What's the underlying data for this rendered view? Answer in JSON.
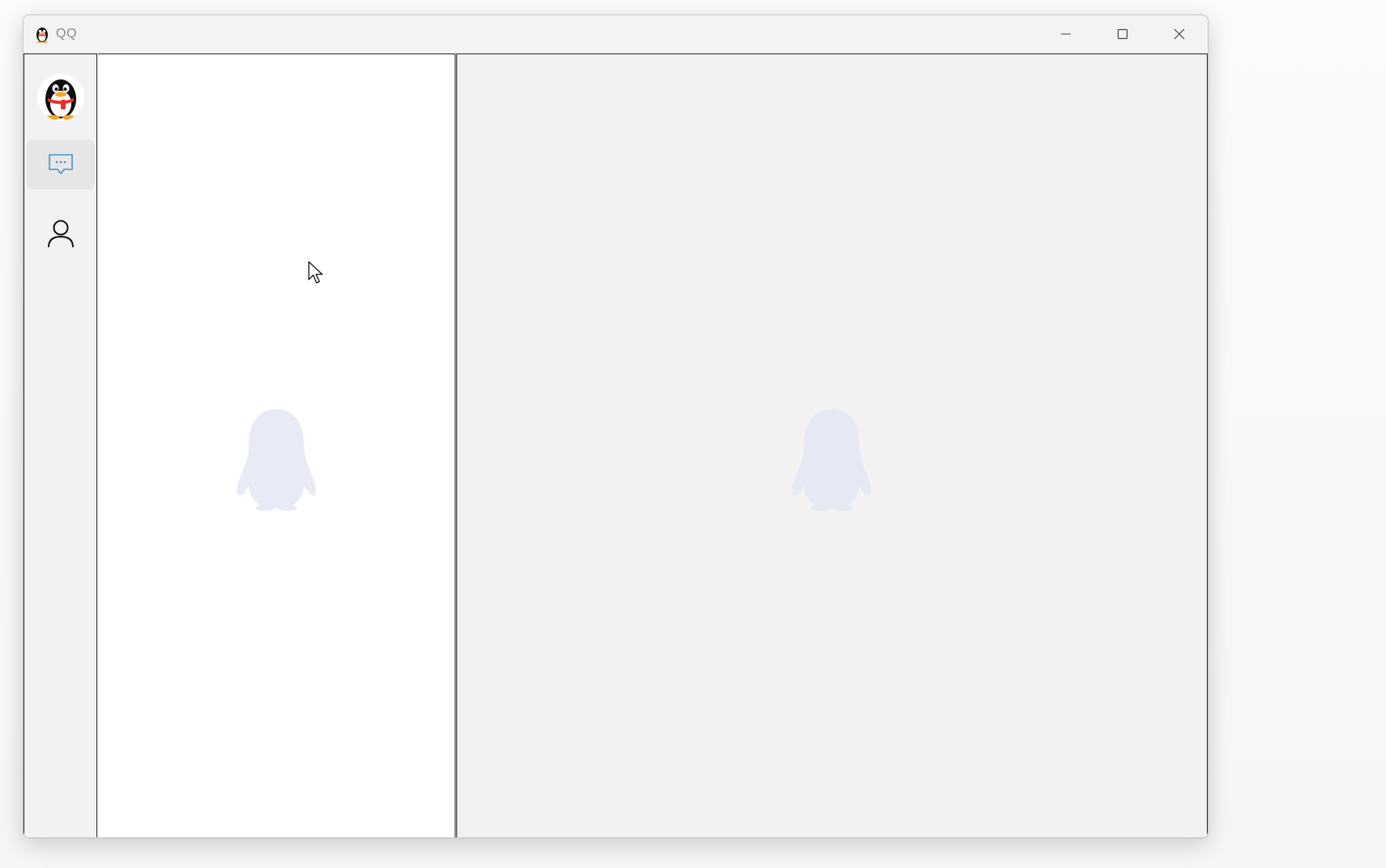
{
  "window": {
    "title": "QQ"
  },
  "title_controls": {
    "minimize_icon": "minimize-icon",
    "maximize_icon": "maximize-icon",
    "close_icon": "close-icon"
  },
  "sidebar": {
    "items": [
      {
        "icon": "chat-bubble-icon",
        "active": true
      },
      {
        "icon": "person-icon",
        "active": false
      }
    ]
  },
  "colors": {
    "accent": "#4a90c8",
    "placeholder": "#e8eaf5",
    "list_bg": "#ffffff",
    "main_bg": "#f2f2f2"
  }
}
